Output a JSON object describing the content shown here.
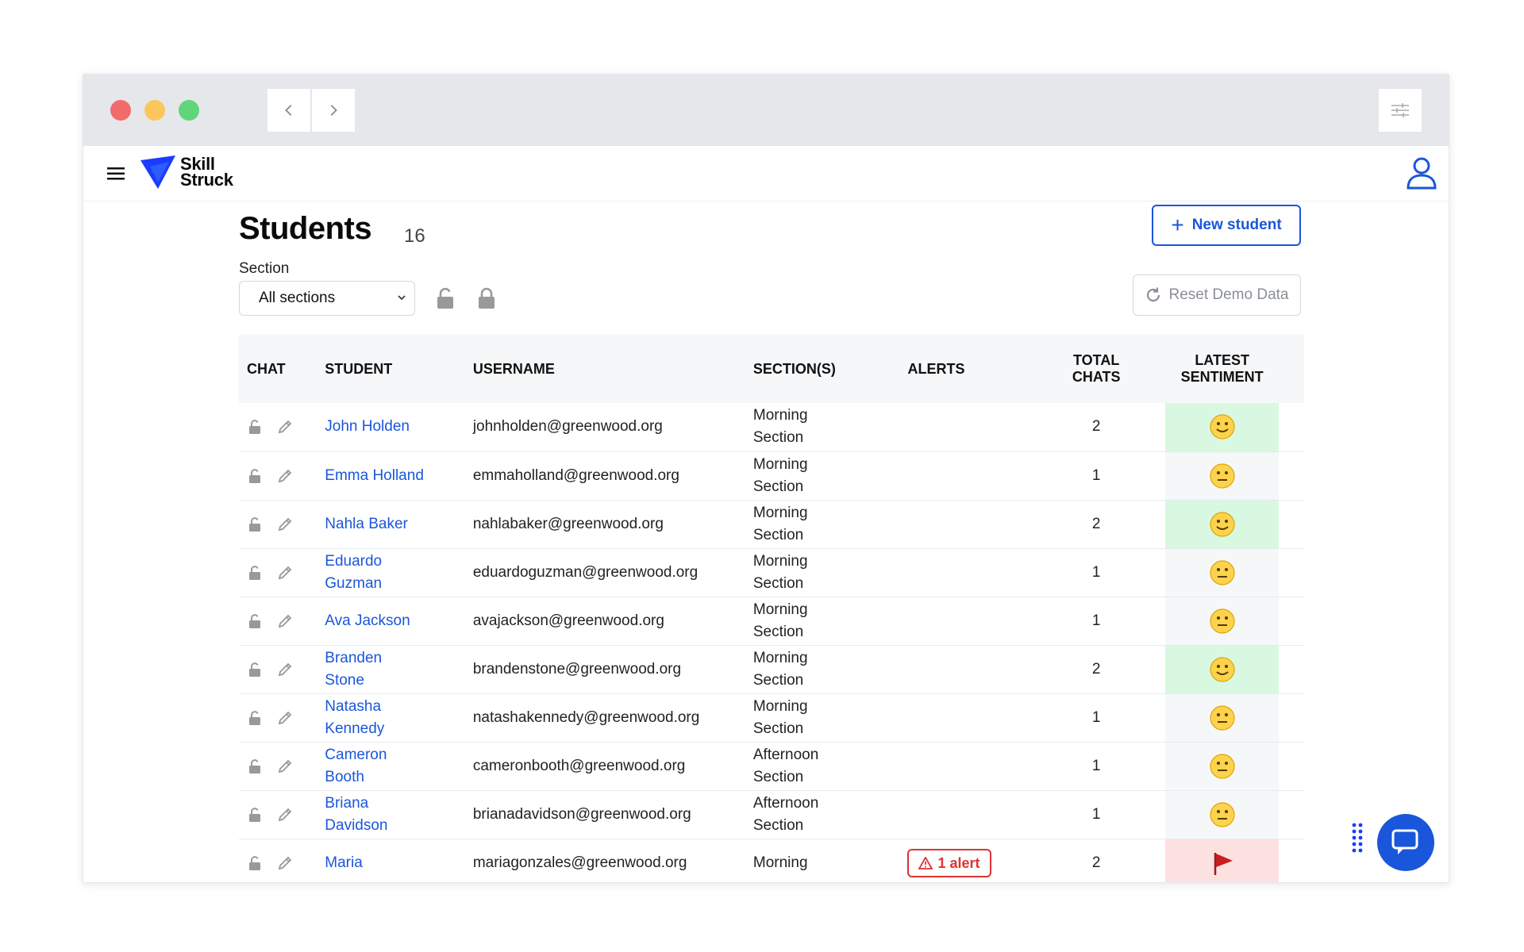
{
  "app": {
    "logo_line1": "Skill",
    "logo_line2": "Struck"
  },
  "page": {
    "title": "Students",
    "count": "16",
    "new_student_label": "New student",
    "section_label": "Section",
    "section_selected": "All sections",
    "reset_label": "Reset Demo Data"
  },
  "table": {
    "headers": {
      "chat": "CHAT",
      "student": "STUDENT",
      "username": "USERNAME",
      "sections": "SECTION(S)",
      "alerts": "ALERTS",
      "total_line1": "TOTAL",
      "total_line2": "CHATS",
      "latest_line1": "LATEST",
      "latest_line2": "SENTIMENT"
    },
    "rows": [
      {
        "name_line1": "John Holden",
        "name_line2": "",
        "username": "johnholden@greenwood.org",
        "section_line1": "Morning",
        "section_line2": "Section",
        "alert": "",
        "total": "2",
        "sentiment": "positive"
      },
      {
        "name_line1": "Emma Holland",
        "name_line2": "",
        "username": "emmaholland@greenwood.org",
        "section_line1": "Morning",
        "section_line2": "Section",
        "alert": "",
        "total": "1",
        "sentiment": "neutral"
      },
      {
        "name_line1": "Nahla Baker",
        "name_line2": "",
        "username": "nahlabaker@greenwood.org",
        "section_line1": "Morning",
        "section_line2": "Section",
        "alert": "",
        "total": "2",
        "sentiment": "positive"
      },
      {
        "name_line1": "Eduardo",
        "name_line2": "Guzman",
        "username": "eduardoguzman@greenwood.org",
        "section_line1": "Morning",
        "section_line2": "Section",
        "alert": "",
        "total": "1",
        "sentiment": "neutral"
      },
      {
        "name_line1": "Ava Jackson",
        "name_line2": "",
        "username": "avajackson@greenwood.org",
        "section_line1": "Morning",
        "section_line2": "Section",
        "alert": "",
        "total": "1",
        "sentiment": "neutral"
      },
      {
        "name_line1": "Branden",
        "name_line2": "Stone",
        "username": "brandenstone@greenwood.org",
        "section_line1": "Morning",
        "section_line2": "Section",
        "alert": "",
        "total": "2",
        "sentiment": "positive"
      },
      {
        "name_line1": "Natasha",
        "name_line2": "Kennedy",
        "username": "natashakennedy@greenwood.org",
        "section_line1": "Morning",
        "section_line2": "Section",
        "alert": "",
        "total": "1",
        "sentiment": "neutral"
      },
      {
        "name_line1": "Cameron",
        "name_line2": "Booth",
        "username": "cameronbooth@greenwood.org",
        "section_line1": "Afternoon",
        "section_line2": "Section",
        "alert": "",
        "total": "1",
        "sentiment": "neutral"
      },
      {
        "name_line1": "Briana",
        "name_line2": "Davidson",
        "username": "brianadavidson@greenwood.org",
        "section_line1": "Afternoon",
        "section_line2": "Section",
        "alert": "",
        "total": "1",
        "sentiment": "neutral"
      },
      {
        "name_line1": "Maria",
        "name_line2": "",
        "username": "mariagonzales@greenwood.org",
        "section_line1": "Morning",
        "section_line2": "",
        "alert": "1 alert",
        "total": "2",
        "sentiment": "negative"
      }
    ]
  },
  "colors": {
    "accent": "#1a56db",
    "positive_bg": "#d9f8e1",
    "negative_bg": "#fde0e0",
    "alert": "#dd3333"
  }
}
